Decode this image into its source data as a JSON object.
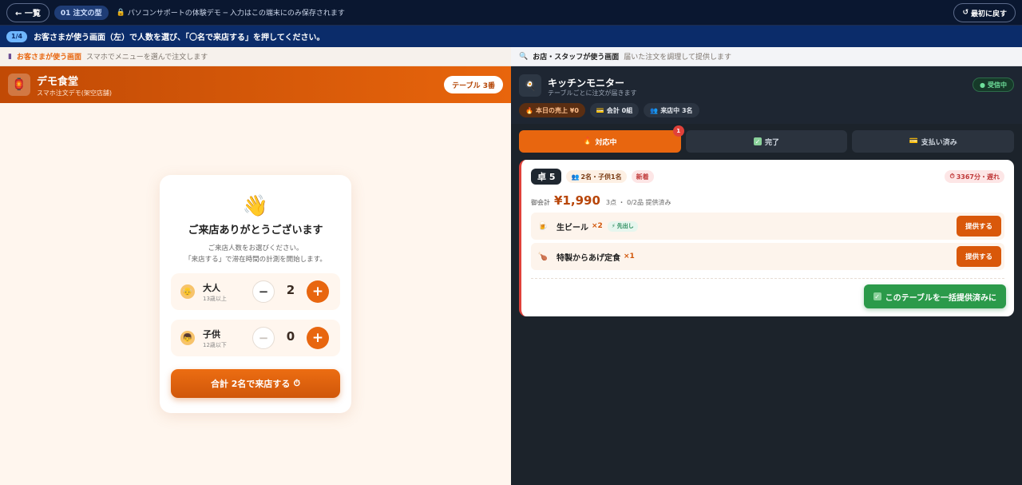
{
  "topbar": {
    "back_label": "← 一覧",
    "chapter": "01 注文の型",
    "note": "パソコンサポートの体験デモ ─ 入力はこの端末にのみ保存されます",
    "reset_label": "最初に戻す"
  },
  "instruction": {
    "step": "1/4",
    "text": "お客さまが使う画面（左）で人数を選び、「〇名で来店する」を押してください。"
  },
  "customer": {
    "panel_title": "お客さまが使う画面",
    "panel_sub": "スマホでメニューを選んで注文します",
    "store_name": "デモ食堂",
    "store_sub": "スマホ注文デモ(架空店舗)",
    "table_label": "テーブル 3番",
    "welcome_title": "ご来店ありがとうございます",
    "welcome_desc1": "ご来店人数をお選びください。",
    "welcome_desc2": "「来店する」で滞在時間の計測を開始します。",
    "adult": {
      "label": "大人",
      "sub": "13歳以上",
      "count": "2"
    },
    "child": {
      "label": "子供",
      "sub": "12歳以下",
      "count": "0"
    },
    "enter_label": "合計 2名で来店する"
  },
  "kitchen": {
    "panel_title": "お店・スタッフが使う画面",
    "panel_sub": "届いた注文を調理して提供します",
    "title": "キッチンモニター",
    "sub": "テーブルごとに注文が届きます",
    "live": "受信中",
    "stats": {
      "sales": "本日の売上 ¥0",
      "groups": "会計 0組",
      "people": "来店中 3名"
    },
    "tabs": [
      {
        "label": "対応中",
        "count": "1"
      },
      {
        "label": "完了"
      },
      {
        "label": "支払い済み"
      }
    ],
    "order": {
      "table": "卓 5",
      "guests": "2名・子供1名",
      "new_tag": "新着",
      "elapsed": "3367分・遅れ",
      "total_label": "御会計",
      "total": "¥1,990",
      "meta": "3点 ・ 0/2品 提供済み",
      "items": [
        {
          "name": "生ビール",
          "qty": "×2",
          "tag": "先出し",
          "serve": "提供する"
        },
        {
          "name": "特製からあげ定食",
          "qty": "×1",
          "serve": "提供する"
        }
      ],
      "bulk_label": "このテーブルを一括提供済みに"
    }
  },
  "colors": {
    "accent": "#e8660f",
    "kitchen_bg": "#1c232b",
    "success": "#2b9a4a",
    "alert": "#e0413a"
  }
}
